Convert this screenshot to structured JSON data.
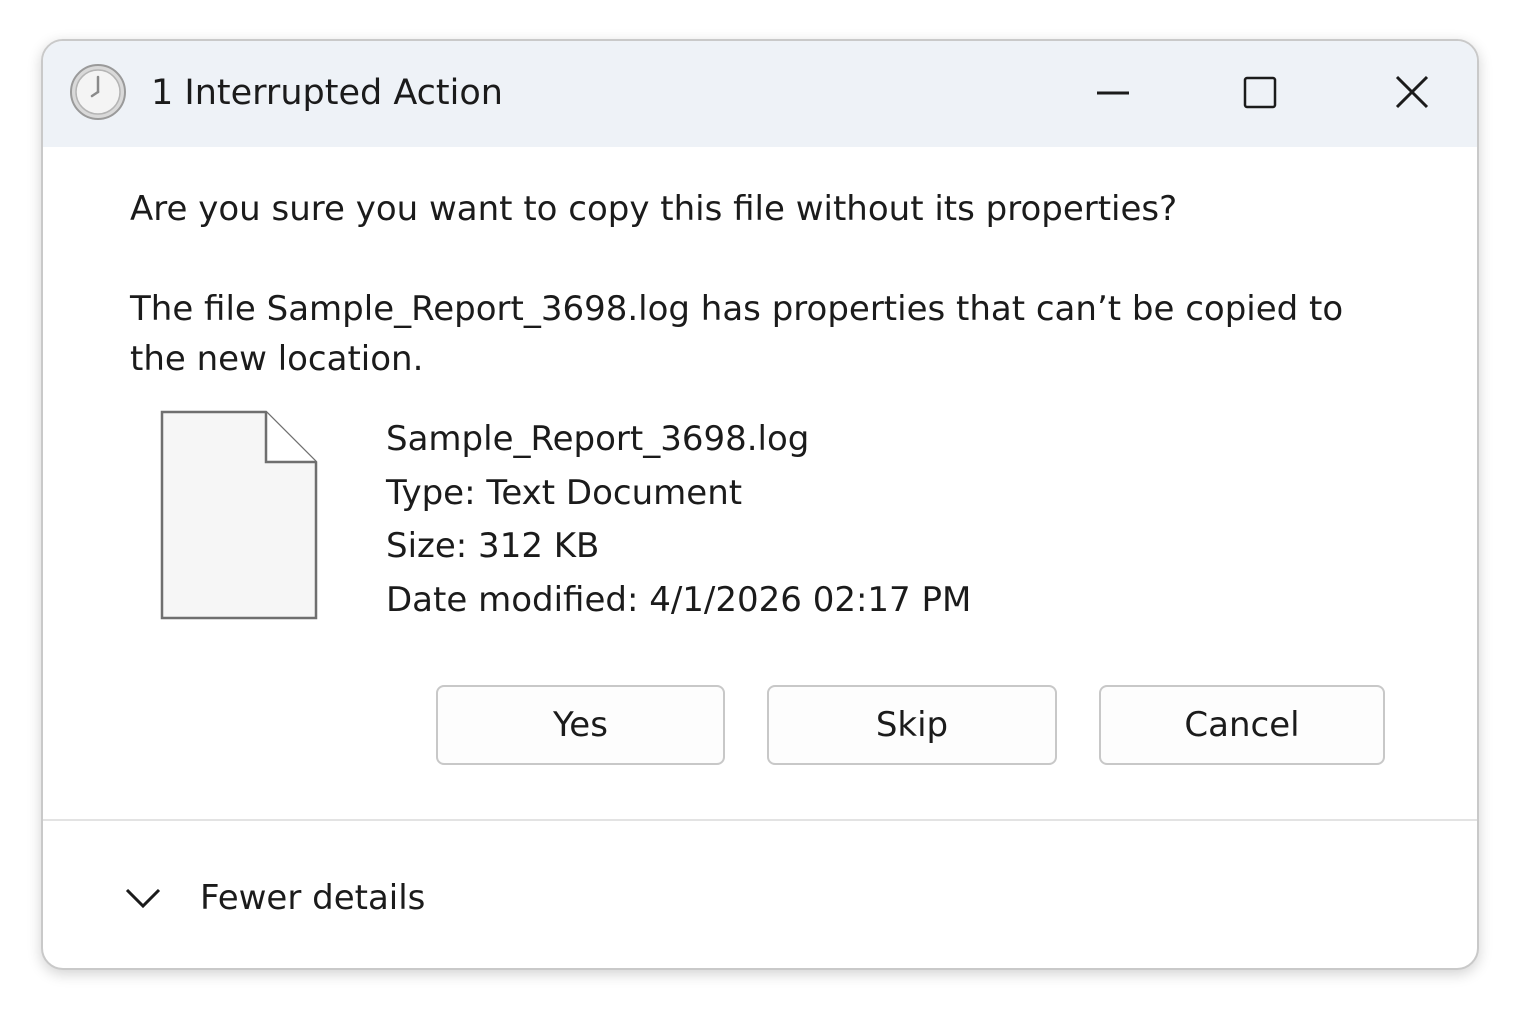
{
  "dialog": {
    "title": "1 Interrupted Action",
    "icon": "clock-icon",
    "window_controls": {
      "minimize": "minimize-icon",
      "maximize": "maximize-icon",
      "close": "close-icon"
    }
  },
  "message": {
    "question": "Are you sure you want to copy this file without its properties?",
    "explanation": "The file Sample_Report_3698.log has properties that can’t be copied to the new location."
  },
  "file": {
    "icon": "document-icon",
    "name": "Sample_Report_3698.log",
    "type": "Type: Text Document",
    "size": "Size: 312 KB",
    "date_modified": "Date modified: 4/1/2026 02:17 PM"
  },
  "buttons": {
    "yes": "Yes",
    "skip": "Skip",
    "cancel": "Cancel"
  },
  "details": {
    "label": "Fewer details",
    "icon": "chevron-down-icon"
  },
  "colors": {
    "titlebar_bg": "#eef2f7",
    "border": "#c8c8c8",
    "text": "#1b1b1b"
  }
}
